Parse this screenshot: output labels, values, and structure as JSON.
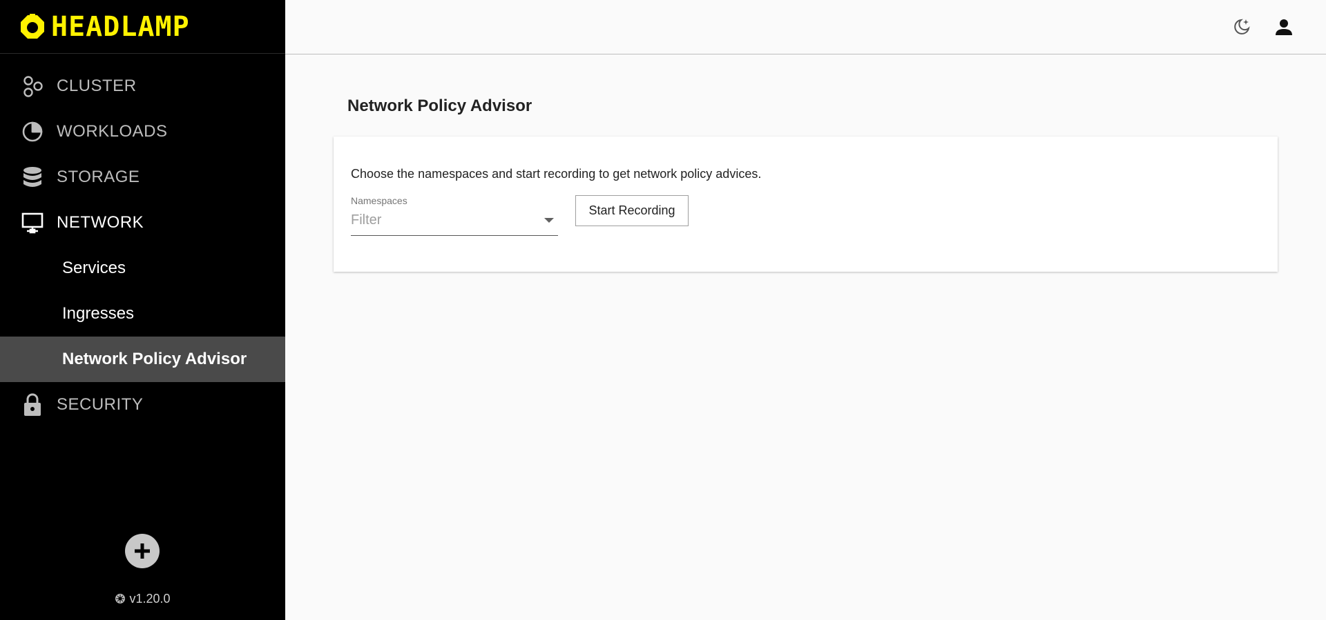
{
  "app": {
    "brand": "HEADLAMP",
    "brand_color": "#fff200",
    "version": "v1.20.0"
  },
  "sidebar": {
    "items": [
      {
        "label": "CLUSTER",
        "icon": "cluster-icon"
      },
      {
        "label": "WORKLOADS",
        "icon": "pie-chart-icon"
      },
      {
        "label": "STORAGE",
        "icon": "database-icon"
      },
      {
        "label": "NETWORK",
        "icon": "network-monitor-icon"
      },
      {
        "label": "SECURITY",
        "icon": "lock-icon"
      }
    ],
    "network_subitems": [
      {
        "label": "Services"
      },
      {
        "label": "Ingresses"
      },
      {
        "label": "Network Policy Advisor",
        "selected": true
      }
    ],
    "add_icon": "add-cluster-icon"
  },
  "topbar": {
    "theme_icon": "dark-mode-moon-icon",
    "user_icon": "account-icon"
  },
  "main": {
    "title": "Network Policy Advisor",
    "description": "Choose the namespaces and start recording to get network policy advices.",
    "namespaces_label": "Namespaces",
    "namespaces_placeholder": "Filter",
    "start_button": "Start Recording"
  }
}
